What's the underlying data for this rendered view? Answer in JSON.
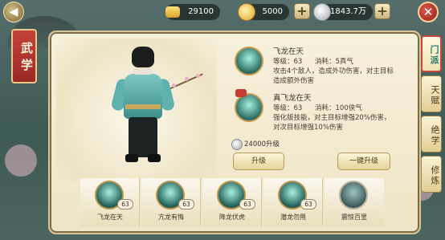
{
  "top_bar": {
    "resources": [
      {
        "icon": "gold-ingot-icon",
        "value": "29100"
      },
      {
        "icon": "gold-coin-icon",
        "value": "5000"
      },
      {
        "icon": "silver-coin-icon",
        "value": "1843.7万"
      }
    ]
  },
  "title": "武学",
  "skill_details": [
    {
      "name": "飞龙在天",
      "level_label": "等级：63",
      "cost_label": "消耗：5真气",
      "desc": "攻击4个敌人，造成外功伤害，对主目标造成额外伤害"
    },
    {
      "name": "真飞龙在天",
      "level_label": "等级：63",
      "cost_label": "消耗：100侠气",
      "desc": "强化版技能，对主目标增强20%伤害，对次目标增强10%伤害"
    }
  ],
  "upgrade_cost": "24000升级",
  "buttons": {
    "upgrade": "升级",
    "one_key_upgrade": "一键升级"
  },
  "skills": [
    {
      "name": "飞龙在天",
      "level": "63",
      "locked": false
    },
    {
      "name": "亢龙有悔",
      "level": "63",
      "locked": false
    },
    {
      "name": "降龙伏虎",
      "level": "63",
      "locked": false
    },
    {
      "name": "潜龙勿用",
      "level": "63",
      "locked": false
    },
    {
      "name": "震惊百里",
      "level": "",
      "locked": true
    }
  ],
  "tabs": [
    {
      "label": "门派",
      "active": true
    },
    {
      "label": "天赋",
      "active": false
    },
    {
      "label": "绝学",
      "active": false
    },
    {
      "label": "修炼",
      "active": false
    }
  ],
  "colors": {
    "accent_red": "#c93a30",
    "accent_teal": "#2a7a6c",
    "panel_bg": "#f3ebd4",
    "gold_border": "#c69a4b"
  }
}
